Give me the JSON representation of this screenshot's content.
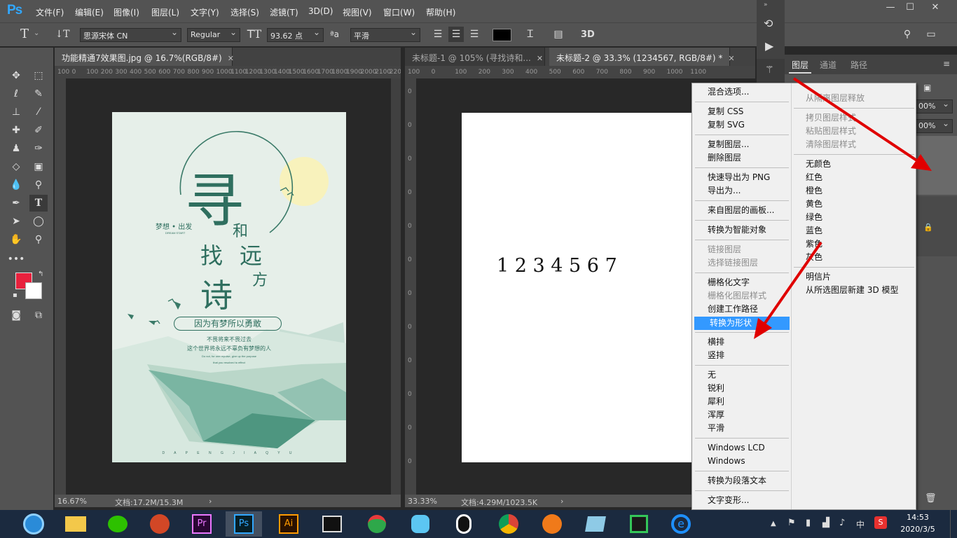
{
  "app": {
    "logo": "Ps"
  },
  "menubar": {
    "items": [
      "文件(F)",
      "编辑(E)",
      "图像(I)",
      "图层(L)",
      "文字(Y)",
      "选择(S)",
      "滤镜(T)",
      "3D(D)",
      "视图(V)",
      "窗口(W)",
      "帮助(H)"
    ]
  },
  "options": {
    "font_family": "思源宋体 CN",
    "font_style": "Regular",
    "font_size": "93.62 点",
    "aa_icon": "ªa",
    "antialias": "平滑",
    "threed": "3D"
  },
  "docs": {
    "left": {
      "tab": "功能精通7效果图.jpg @ 16.7%(RGB/8#)",
      "ruler": [
        "100",
        "0",
        "100",
        "200",
        "300",
        "400",
        "500",
        "600",
        "700",
        "800",
        "900",
        "1000",
        "1100",
        "1200",
        "1300",
        "1400",
        "1500",
        "1600",
        "1700",
        "1800",
        "1900",
        "2000",
        "2100",
        "2200"
      ],
      "zoom": "16.67%",
      "doc_info": "文档:17.2M/15.3M"
    },
    "right": {
      "tab1": "未标题-1 @ 105% (寻找诗和...",
      "tab2": "未标题-2 @ 33.3% (1234567, RGB/8#) *",
      "ruler": [
        "100",
        "0",
        "100",
        "200",
        "300",
        "400",
        "500",
        "600",
        "700",
        "800",
        "900",
        "1000",
        "1100"
      ],
      "vruler": [
        "0",
        "0",
        "0",
        "0",
        "0",
        "0",
        "0",
        "0",
        "0",
        "0",
        "0",
        "0"
      ],
      "canvas_text": "1 2 3 4 5 6 7",
      "zoom": "33.33%",
      "doc_info": "文档:4.29M/1023.5K"
    }
  },
  "poster": {
    "big1": "寻",
    "he": "和",
    "zhao": "找",
    "yuan": "远",
    "shi": "诗",
    "fang": "方",
    "dream": "梦想 • 出发",
    "dream_sub": "DREAM START",
    "slogan": "因为有梦所以勇敢",
    "line1": "不畏将来不畏过去",
    "line2": "这个世界将永远不辜负有梦想的人",
    "en1": "Do not, for one repulse, give up the purpose",
    "en2": "that you resolved to effect",
    "bottom": "D A P E N G J I A Q Y U",
    "colors": {
      "bg": "#e5efe8",
      "green": "#2f6f5f",
      "moon": "#f7f1b8"
    }
  },
  "panel": {
    "tabs": [
      "图层",
      "通道",
      "路径"
    ],
    "opacity1": "00%",
    "opacity2": "00%"
  },
  "context_menu": {
    "left": {
      "g1": [
        "混合选项..."
      ],
      "g2": [
        "复制 CSS",
        "复制 SVG"
      ],
      "g3": [
        "复制图层...",
        "删除图层"
      ],
      "g4": [
        "快速导出为 PNG",
        "导出为..."
      ],
      "g5": [
        "来自图层的画板..."
      ],
      "g6": [
        "转换为智能对象"
      ],
      "g7": [
        "链接图层",
        "选择链接图层"
      ],
      "g8": [
        "栅格化文字",
        "栅格化图层样式",
        "创建工作路径",
        "转换为形状"
      ],
      "g9": [
        "横排",
        "竖排"
      ],
      "g10": [
        "无",
        "锐利",
        "犀利",
        "浑厚",
        "平滑"
      ],
      "g11": [
        "Windows LCD",
        "Windows"
      ],
      "g12": [
        "转换为段落文本"
      ],
      "g13": [
        "文字变形..."
      ]
    },
    "right": {
      "g1": [
        "从隔离图层释放"
      ],
      "g2": [
        "拷贝图层样式",
        "粘贴图层样式",
        "清除图层样式"
      ],
      "g3": [
        "无颜色",
        "红色",
        "橙色",
        "黄色",
        "绿色",
        "蓝色",
        "紫色",
        "灰色"
      ],
      "g4": [
        "明信片",
        "从所选图层新建 3D 模型"
      ]
    }
  },
  "taskbar": {
    "apps": [
      "ie",
      "files",
      "wechat",
      "powerpoint",
      "premiere",
      "photoshop",
      "illustrator",
      "video",
      "game",
      "bird",
      "qq",
      "chrome",
      "ball",
      "paper",
      "green",
      "ie2"
    ],
    "app_labels": {
      "pr": "Pr",
      "ps": "Ps",
      "ai": "Ai"
    },
    "tray_lang": "中",
    "time": "14:53",
    "date": "2020/3/5"
  },
  "colors": {
    "fg_swatch": "#e8213d",
    "highlight": "#3399ff",
    "arrow": "#e00000"
  }
}
